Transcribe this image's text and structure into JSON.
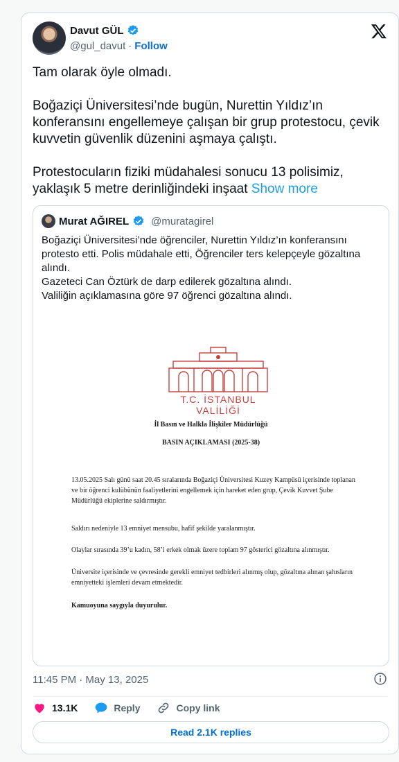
{
  "author": {
    "name": "Davut GÜL",
    "handle": "@gul_davut",
    "separator": "·",
    "follow_label": "Follow"
  },
  "tweet": {
    "text": "Tam olarak öyle olmadı.\n\nBoğaziçi Üniversitesi’nde bugün, Nurettin Yıldız’ın konferansını engellemeye çalışan bir grup protestocu, çevik kuvvetin güvenlik düzenini aşmaya çalıştı.\n\nProtestocuların fiziki müdahalesi sonucu 13 polisimiz, yaklaşık 5 metre derinliğindeki inşaat ",
    "show_more": "Show more"
  },
  "quote": {
    "name": "Murat AĞIREL",
    "handle": "@muratagirel",
    "text": "Boğaziçi Üniversitesi’nde öğrenciler, Nurettin Yıldız’ın konferansını protesto etti. Polis müdahale etti, Öğrenciler ters kelepçeyle gözaltına alındı.\nGazeteci Can Öztürk de darp edilerek gözaltına alındı.\nValiliğin açıklamasına göre 97 öğrenci gözaltına alındı.",
    "document": {
      "logo_text": "T.C. İSTANBUL VALİLİĞİ",
      "department": "İl Basın ve Halkla İlişkiler Müdürlüğü",
      "title": "BASIN AÇIKLAMASI (2025-38)",
      "paragraphs": [
        "13.05.2025 Salı günü saat 20.45 sıralarında Boğaziçi Üniversitesi Kuzey Kampüsü içerisinde toplanan ve bir öğrenci kulübünün faaliyetlerini engellemek için hareket eden grup, Çevik Kuvvet Şube Müdürlüğü ekiplerine saldırmıştır.",
        "Saldırı nedeniyle 13 emniyet mensubu, hafif şekilde yaralanmıştır.",
        "Olaylar sırasında 39’u kadın, 58’i erkek olmak üzere toplam 97 gösterici gözaltına alınmıştır.",
        "Üniversite içerisinde ve çevresinde gerekli emniyet tedbirleri alınmış olup, gözaltına alınan şahısların emniyetteki işlemleri devam etmektedir.",
        "Kamuoyuna saygıyla duyurulur."
      ]
    }
  },
  "meta": {
    "timestamp": "11:45 PM · May 13, 2025"
  },
  "actions": {
    "likes": "13.1K",
    "reply_label": "Reply",
    "copy_label": "Copy link"
  },
  "replies_button": "Read 2.1K replies",
  "colors": {
    "accent": "#1d9bf0",
    "like": "#f91880",
    "logo_red": "#c8423f"
  },
  "icons": [
    "verified-badge-icon",
    "x-logo-icon",
    "info-icon",
    "heart-icon",
    "reply-icon",
    "link-icon"
  ]
}
